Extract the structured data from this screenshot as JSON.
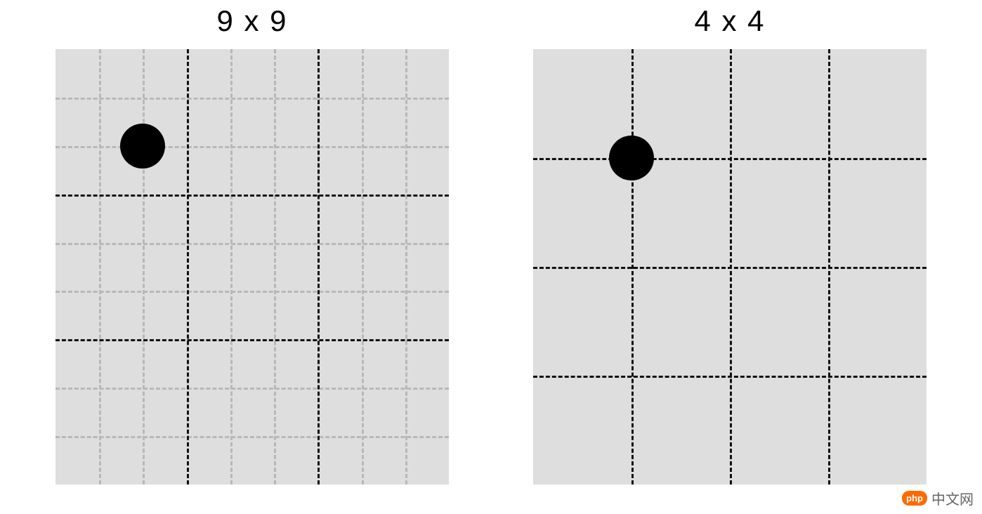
{
  "left": {
    "title": "9 x 9",
    "grid_fine": 9,
    "grid_coarse": 3,
    "dot": {
      "col_fine": 2,
      "row_fine": 2
    }
  },
  "right": {
    "title": "4 x 4",
    "grid": 4,
    "dot": {
      "col": 1,
      "row": 1
    }
  },
  "watermark": {
    "badge": "php",
    "text": "中文网"
  }
}
